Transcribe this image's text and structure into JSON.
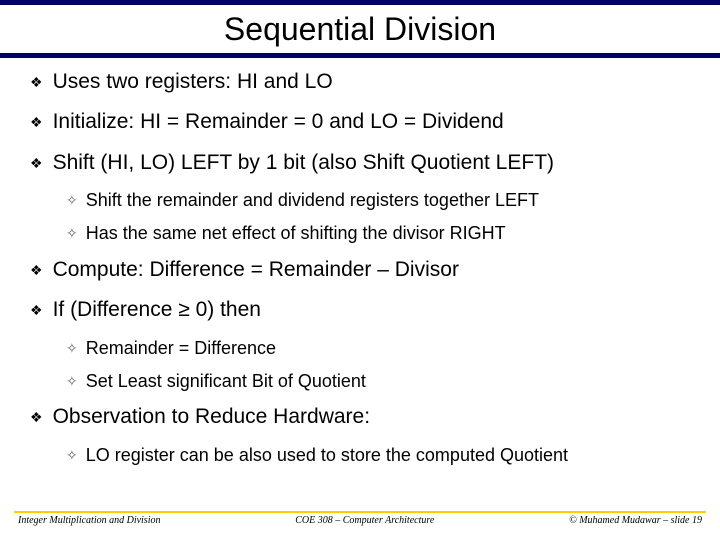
{
  "title": "Sequential Division",
  "bullets": {
    "b0": "Uses two registers: HI and LO",
    "b1": "Initialize: HI = Remainder = 0 and LO = Dividend",
    "b2": "Shift (HI, LO) LEFT by 1 bit (also Shift Quotient LEFT)",
    "b2_subs": {
      "s0": "Shift the remainder and dividend registers together LEFT",
      "s1": "Has the same net effect of shifting the divisor RIGHT"
    },
    "b3": "Compute: Difference = Remainder – Divisor",
    "b4": "If (Difference ≥ 0) then",
    "b4_subs": {
      "s0": "Remainder = Difference",
      "s1": "Set Least significant Bit of Quotient"
    },
    "b5": "Observation to Reduce Hardware:",
    "b5_subs": {
      "s0": "LO register can be also used to store the computed Quotient"
    }
  },
  "footer": {
    "left": "Integer Multiplication and Division",
    "center": "COE 308 – Computer Architecture",
    "right": "© Muhamed Mudawar – slide 19"
  }
}
